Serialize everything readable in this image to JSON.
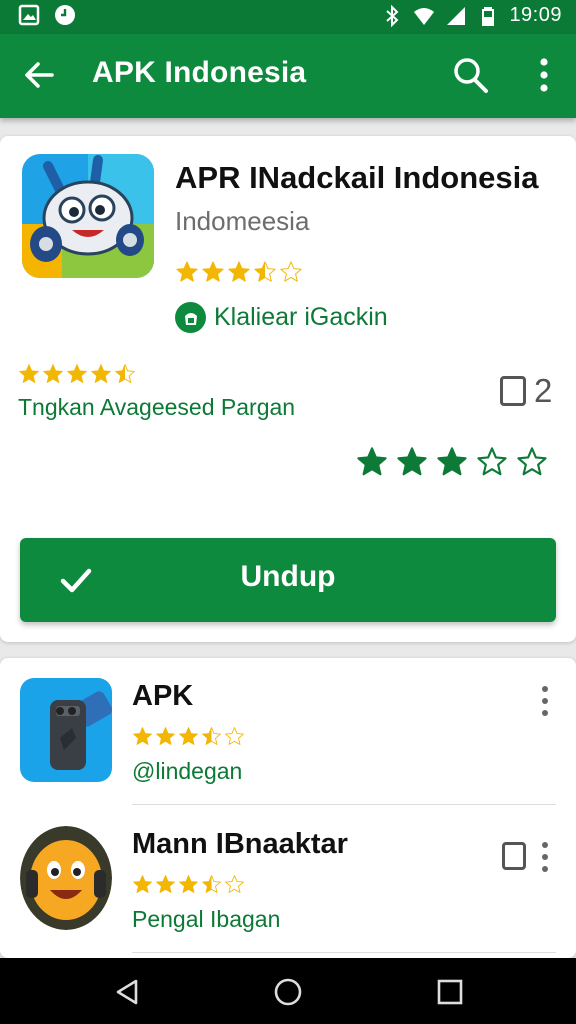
{
  "status_bar": {
    "time": "19:09"
  },
  "app_bar": {
    "title": "APK Indonesia"
  },
  "main_app": {
    "title": "APR INadckail Indonesia",
    "subtitle": "Indomeesia",
    "rating_stars": 3.5,
    "developer": "Klaliear iGackin",
    "community_rating_stars": 4.5,
    "community_label": "Tngkan Avageesed Pargan",
    "count": "2",
    "green_rating_stars": 3,
    "install_label": "Undup"
  },
  "list": [
    {
      "name": "APK",
      "rating_stars": 3.5,
      "developer": "@lindegan",
      "has_checkbox": false
    },
    {
      "name": "Mann IBnaaktar",
      "rating_stars": 3.5,
      "developer": "Pengal Ibagan",
      "has_checkbox": true
    }
  ],
  "colors": {
    "primary": "#0e8a3e",
    "status_bar": "#0b7a37",
    "star": "#f2b705",
    "dev_text": "#0c7a36"
  },
  "icons": [
    "back-arrow-icon",
    "search-icon",
    "more-vert-icon",
    "check-icon",
    "nav-back-icon",
    "nav-home-icon",
    "nav-recents-icon"
  ]
}
